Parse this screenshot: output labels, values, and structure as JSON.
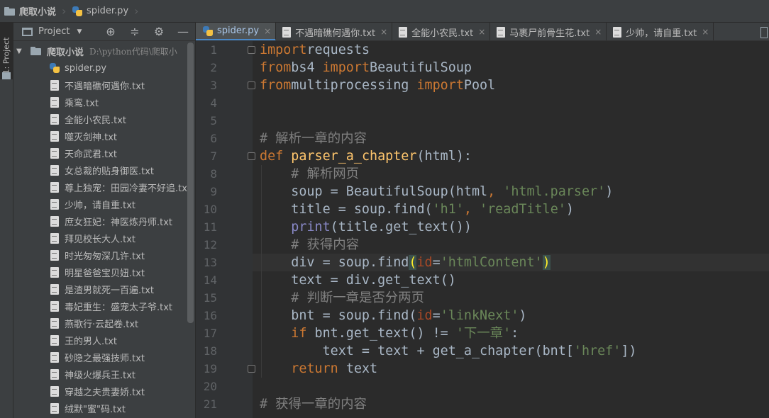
{
  "nav": {
    "project": "爬取小说",
    "file": "spider.py"
  },
  "toolstrip": {
    "project_tab": "1: Project"
  },
  "panel": {
    "title": "Project",
    "caret": "▼",
    "buttons": {
      "locate": "⊕",
      "collapse": "≑",
      "settings": "⚙",
      "hide": "—"
    }
  },
  "tree": {
    "root_name": "爬取小说",
    "root_path": "D:\\python代码\\爬取小",
    "files": [
      "spider.py",
      "不遇暗礁何遇你.txt",
      "乘鸾.txt",
      "全能小农民.txt",
      "噬灭剑神.txt",
      "天命武君.txt",
      "女总裁的贴身御医.txt",
      "尊上独宠：田园冷妻不好追.txt",
      "少帅，请自重.txt",
      "庶女狂妃：神医炼丹师.txt",
      "拜见校长大人.txt",
      "时光匆匆深几许.txt",
      "明星爸爸宝贝妞.txt",
      "是渣男就死一百遍.txt",
      "毒妃重生：盛宠太子爷.txt",
      "燕歌行·云起卷.txt",
      "王的男人.txt",
      "砂隐之最强技师.txt",
      "神级火爆兵王.txt",
      "穿越之夫贵妻娇.txt",
      "绒默\"蜜\"码.txt"
    ]
  },
  "tabs": [
    {
      "label": "spider.py",
      "type": "py",
      "active": true
    },
    {
      "label": "不遇暗礁何遇你.txt",
      "type": "txt"
    },
    {
      "label": "全能小农民.txt",
      "type": "txt"
    },
    {
      "label": "马裹尸前骨生花.txt",
      "type": "txt"
    },
    {
      "label": "少帅，请自重.txt",
      "type": "txt"
    }
  ],
  "tab_close_glyph": "×",
  "editor": {
    "current_line": 13,
    "line_numbers": [
      "1",
      "2",
      "3",
      "4",
      "5",
      "6",
      "7",
      "8",
      "9",
      "10",
      "11",
      "12",
      "13",
      "14",
      "15",
      "16",
      "17",
      "18",
      "19",
      "20",
      "21"
    ],
    "lines": [
      [
        [
          "kw",
          "import"
        ],
        [
          "",
          "requests"
        ]
      ],
      [
        [
          "kw",
          "from"
        ],
        [
          "",
          "bs4 "
        ],
        [
          "kw",
          "import"
        ],
        [
          "",
          "BeautifulSoup"
        ]
      ],
      [
        [
          "kw",
          "from"
        ],
        [
          "",
          "multiprocessing "
        ],
        [
          "kw",
          "import"
        ],
        [
          "",
          "Pool"
        ]
      ],
      [],
      [],
      [
        [
          "cmt",
          "# 解析一章的内容"
        ]
      ],
      [
        [
          "kw",
          "def "
        ],
        [
          "fn",
          "parser_a_chapter"
        ],
        [
          "",
          "(html):"
        ]
      ],
      [
        [
          "",
          "    "
        ],
        [
          "cmt",
          "# 解析网页"
        ]
      ],
      [
        [
          "",
          "    soup = BeautifulSoup(html"
        ],
        [
          "pn",
          ","
        ],
        [
          "",
          ""
        ],
        [
          "str",
          " 'html.parser'"
        ],
        [
          "",
          ")"
        ]
      ],
      [
        [
          "",
          "    title = soup.find("
        ],
        [
          "str",
          "'h1'"
        ],
        [
          "pn",
          ","
        ],
        [
          "str",
          " 'readTitle'"
        ],
        [
          "",
          ")"
        ]
      ],
      [
        [
          "",
          "    "
        ],
        [
          "bi",
          "print"
        ],
        [
          "",
          "(title.get_text())"
        ]
      ],
      [
        [
          "",
          "    "
        ],
        [
          "cmt",
          "# 获得内容"
        ]
      ],
      [
        [
          "",
          "    div = soup.find"
        ],
        [
          "brace-hl",
          "("
        ],
        [
          "param",
          "id"
        ],
        [
          "",
          "="
        ],
        [
          "str",
          "'htmlContent'"
        ],
        [
          "brace-hl",
          ")"
        ]
      ],
      [
        [
          "",
          "    text = div.get_text()"
        ]
      ],
      [
        [
          "",
          "    "
        ],
        [
          "cmt",
          "# 判断一章是否分两页"
        ]
      ],
      [
        [
          "",
          "    bnt = soup.find("
        ],
        [
          "param",
          "id"
        ],
        [
          "",
          "="
        ],
        [
          "str",
          "'linkNext'"
        ],
        [
          "",
          ")"
        ]
      ],
      [
        [
          "",
          "    "
        ],
        [
          "kw",
          "if "
        ],
        [
          "",
          "bnt.get_text() != "
        ],
        [
          "str",
          "'下一章'"
        ],
        [
          "",
          ":"
        ]
      ],
      [
        [
          "",
          "        text = text + get_a_chapter(bnt["
        ],
        [
          "str",
          "'href'"
        ],
        [
          "",
          "])"
        ]
      ],
      [
        [
          "",
          "    "
        ],
        [
          "kw",
          "return "
        ],
        [
          "",
          "text"
        ]
      ],
      [],
      [
        [
          "cmt",
          "# 获得一章的内容"
        ]
      ]
    ]
  },
  "icons": {
    "folder": "folder-icon",
    "python_file": "python-file-icon",
    "text_file": "text-file-icon"
  },
  "colors": {
    "keyword": "#cc7832",
    "function": "#ffc66d",
    "string": "#6a8759",
    "comment": "#808080",
    "builtin": "#8888c6",
    "param": "#aa4926",
    "active_tab_underline": "#4a88c7"
  }
}
